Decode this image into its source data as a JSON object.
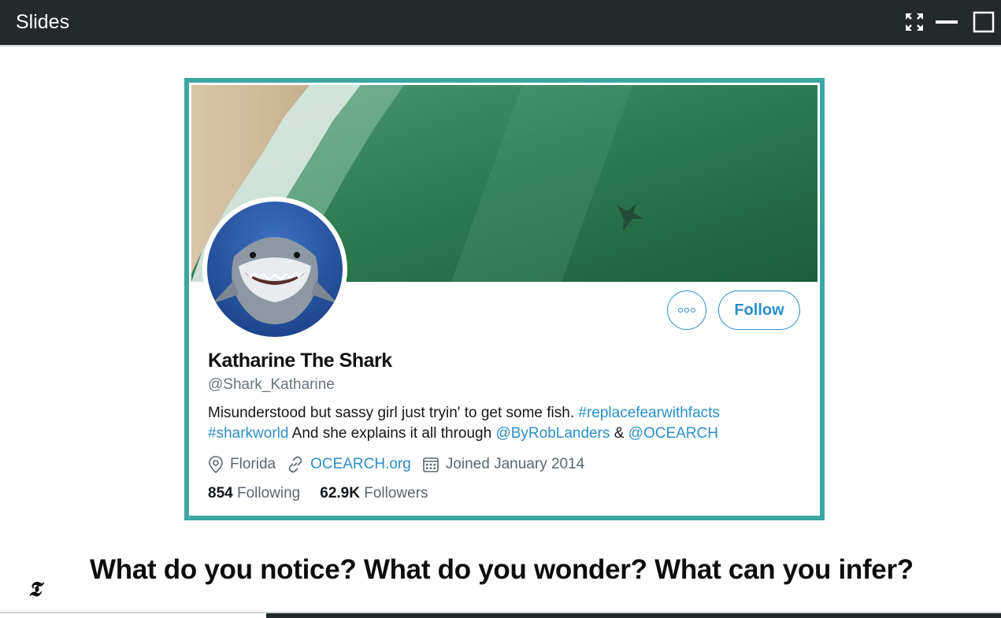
{
  "window": {
    "title": "Slides",
    "controls": [
      "expand-icon",
      "minimize-icon",
      "maximize-icon"
    ]
  },
  "profile": {
    "name": "Katharine The Shark",
    "handle": "@Shark_Katharine",
    "more_icon": "more-options-icon",
    "follow_label": "Follow",
    "bio": {
      "text1": "Misunderstood but sassy girl just tryin' to get some fish. ",
      "hashtag1": "#replacefearwithfacts",
      "hashtag2": "#sharkworld",
      "text2": " And she explains it all through ",
      "mention1": "@ByRobLanders",
      "text3": " & ",
      "mention2": "@OCEARCH"
    },
    "location": "Florida",
    "website": "OCEARCH.org",
    "joined": "Joined January 2014",
    "following_count": "854",
    "following_label": "Following",
    "followers_count": "62.9K",
    "followers_label": "Followers"
  },
  "caption": {
    "logo": "𝕿",
    "prompt": "What do you notice?  What do you wonder?  What can you infer?"
  },
  "colors": {
    "titlebar": "#24292c",
    "card_border": "#3ba7a3",
    "link": "#2b8ec9"
  }
}
